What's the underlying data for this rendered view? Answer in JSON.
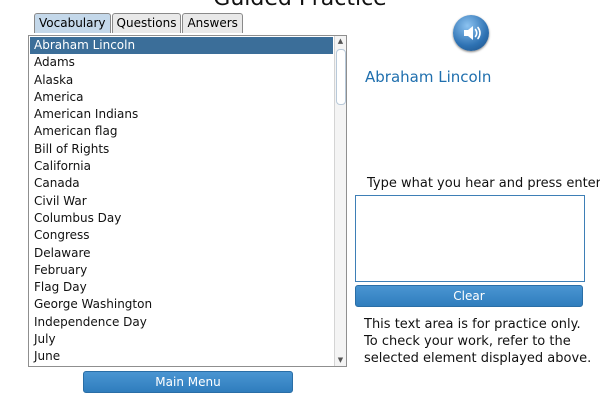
{
  "header": {
    "title": "Guided Practice"
  },
  "tabs": [
    {
      "label": "Vocabulary",
      "active": true
    },
    {
      "label": "Questions",
      "active": false
    },
    {
      "label": "Answers",
      "active": false
    }
  ],
  "vocabulary_list": {
    "selected_index": 0,
    "items": [
      "Abraham Lincoln",
      "Adams",
      "Alaska",
      "America",
      "American Indians",
      "American flag",
      "Bill of Rights",
      "California",
      "Canada",
      "Civil War",
      "Columbus Day",
      "Congress",
      "Delaware",
      "February",
      "Flag Day",
      "George Washington",
      "Independence Day",
      "July",
      "June"
    ]
  },
  "speaker": {
    "icon": "speaker-icon"
  },
  "selected_word": "Abraham Lincoln",
  "practice": {
    "instruction": "Type what you hear and press enter.",
    "value": "",
    "clear_label": "Clear",
    "note_lines": [
      "This text area is for practice only.",
      "To check your work, refer to the",
      "selected element displayed above."
    ]
  },
  "footer": {
    "main_menu_label": "Main Menu"
  },
  "colors": {
    "accent": "#2f7dbd",
    "selected_row": "#3b6e99",
    "word_text": "#1f6fae"
  }
}
